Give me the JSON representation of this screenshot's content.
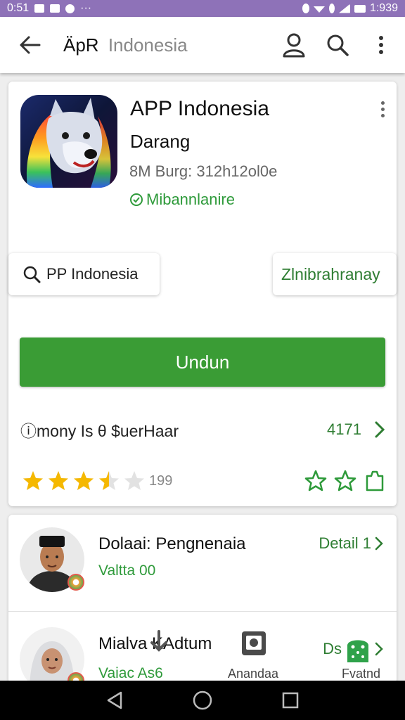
{
  "status_bar": {
    "time": "0:51",
    "dots": "···",
    "clock_right": "1:939",
    "colors": {
      "bg": "#8e72b8"
    }
  },
  "app_bar": {
    "title_main": "ÄpR",
    "title_sub": "Indonesia",
    "icons": [
      "back-arrow-icon",
      "account-icon",
      "search-icon",
      "more-vertical-icon"
    ]
  },
  "app_card": {
    "name": "APP Indonesia",
    "developer": "Darang",
    "meta": "8M Burg: 312h12ol0e",
    "category": "Mibannlanire",
    "chip_search_label": "PP Indonesia",
    "chip_alt_label": "Zlnibrahranay",
    "install_label": "Undun",
    "info_text": "ⓘmony Is θ $uerHaar",
    "info_value": "4171",
    "rating_value": 3.5,
    "rating_max": 5,
    "rating_count": "199",
    "colors": {
      "accent": "#3a9c35",
      "star": "#f5b800"
    }
  },
  "people": [
    {
      "name": "Dolaai: Pengnenaia",
      "sub": "Valtta 00",
      "link_label": "Detail 1"
    },
    {
      "name": "Mialva KAdtum",
      "sub": "Vaiac As6",
      "mid_caption": "Anandaa",
      "link_label": "Ds",
      "right_caption": "Fvatnd"
    }
  ]
}
